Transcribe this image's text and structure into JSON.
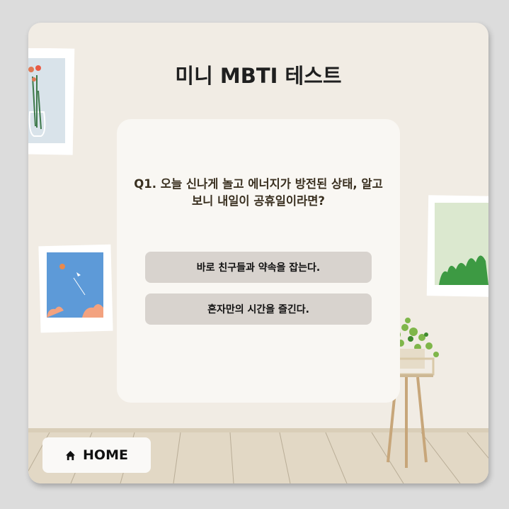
{
  "app": {
    "title": "미니 MBTI 테스트"
  },
  "quiz": {
    "question": "Q1. 오늘 신나게 놀고 에너지가 방전된 상태, 알고 보니 내일이 공휴일이라면?",
    "answers": [
      {
        "label": "바로 친구들과 약속을 잡는다."
      },
      {
        "label": "혼자만의 시간을 즐긴다."
      }
    ]
  },
  "nav": {
    "home_label": "HOME",
    "home_icon": "home-icon"
  },
  "colors": {
    "wall": "#f1ece4",
    "card": "#f9f7f3",
    "answer_button": "#d8d3ce",
    "floor": "#e2d8c5"
  }
}
